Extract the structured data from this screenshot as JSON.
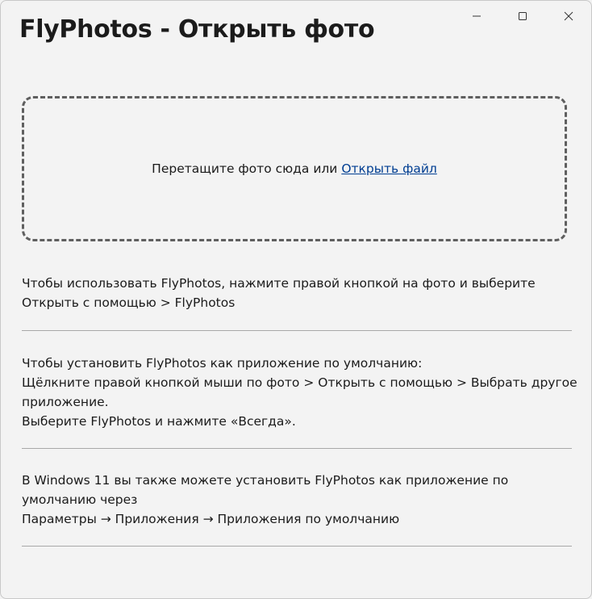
{
  "window": {
    "title": "FlyPhotos - Открыть фото",
    "controls": {
      "minimize_icon": "minimize-icon",
      "maximize_icon": "maximize-icon",
      "close_icon": "close-icon"
    }
  },
  "dropzone": {
    "prompt": "Перетащите фото сюда или ",
    "open_file_link": "Открыть файл"
  },
  "sections": {
    "usage": {
      "line1": "Чтобы использовать FlyPhotos, нажмите правой кнопкой на фото и выберите",
      "line2": "Открыть с помощью > FlyPhotos"
    },
    "default_app": {
      "line1": "Чтобы установить FlyPhotos как приложение по умолчанию:",
      "line2": "Щёлкните правой кнопкой мыши по фото > Открыть с помощью > Выбрать другое",
      "line3": "приложение.",
      "line4": "Выберите FlyPhotos и нажмите «Всегда»."
    },
    "windows11": {
      "line1": "В Windows 11 вы также можете установить FlyPhotos как приложение по",
      "line2": "умолчанию через",
      "line3": "Параметры → Приложения → Приложения по умолчанию"
    }
  },
  "colors": {
    "background": "#f3f3f3",
    "link": "#003e92",
    "dropzone_border": "#5f5f5f",
    "divider": "#a8a8a8"
  }
}
